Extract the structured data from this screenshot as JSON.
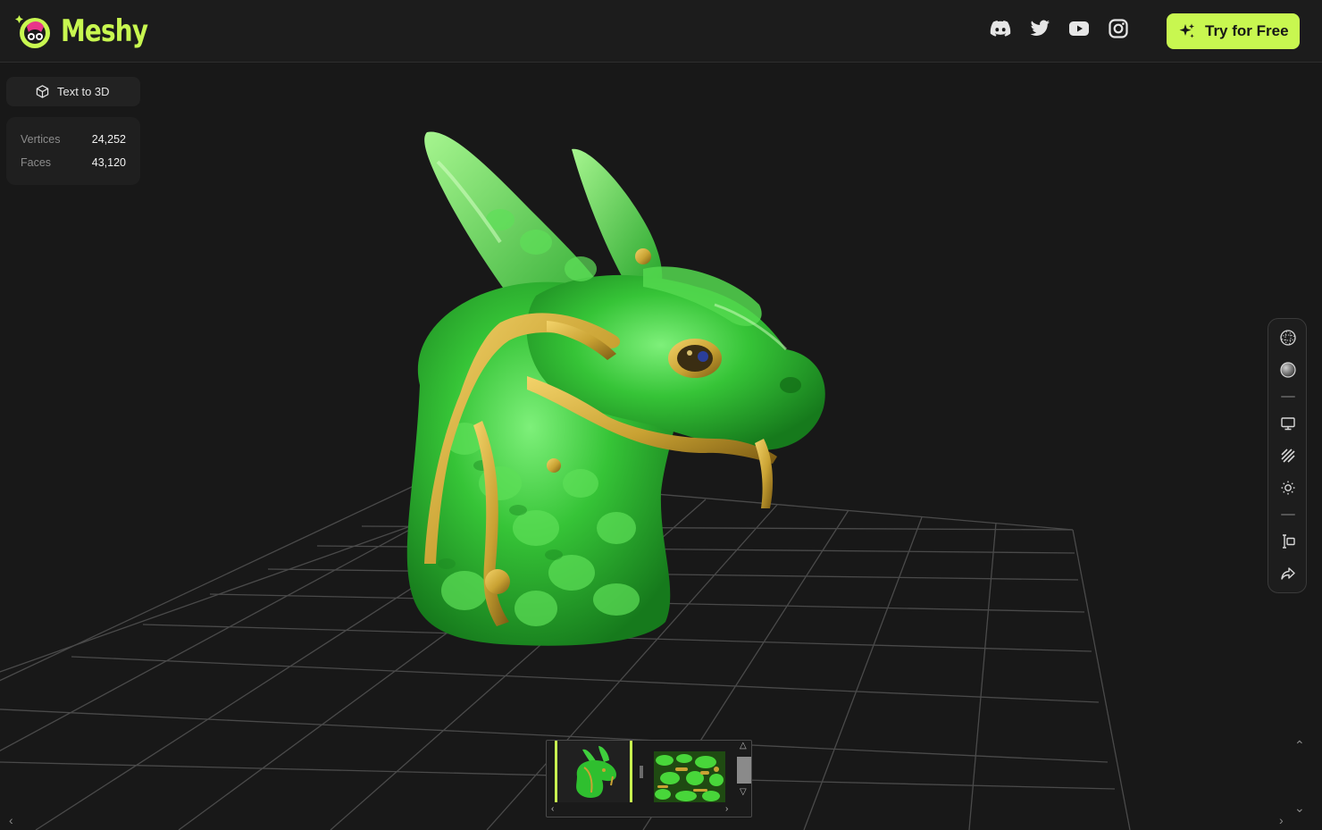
{
  "brand": {
    "name": "Meshy",
    "accent": "#c8f750",
    "background": "#181818"
  },
  "header": {
    "socials": [
      {
        "name": "discord-icon"
      },
      {
        "name": "twitter-icon"
      },
      {
        "name": "youtube-icon"
      },
      {
        "name": "instagram-icon"
      }
    ],
    "cta_label": "Try for Free"
  },
  "mode": {
    "label": "Text to 3D",
    "icon": "cube-icon"
  },
  "stats": {
    "vertices_label": "Vertices",
    "vertices_value": "24,252",
    "faces_label": "Faces",
    "faces_value": "43,120"
  },
  "toolbar": {
    "items": [
      "wireframe-sphere-icon",
      "shaded-sphere-icon",
      "screen-icon",
      "texture-hatch-icon",
      "light-icon",
      "measure-icon",
      "share-icon"
    ]
  },
  "model": {
    "subject": "green jade dragon head with gold ornaments",
    "colors": {
      "jade": "#2fbf2f",
      "gold": "#c9a233"
    }
  },
  "thumbnails": [
    {
      "name": "model-preview-thumbnail",
      "selected": true
    },
    {
      "name": "texture-map-thumbnail",
      "selected": false
    }
  ]
}
